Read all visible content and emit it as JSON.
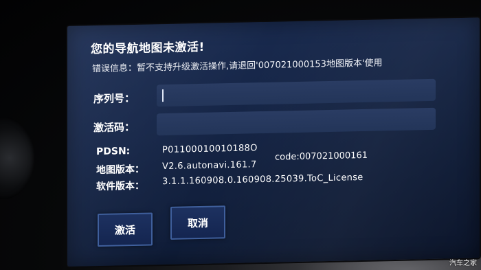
{
  "dialog": {
    "title": "您的导航地图未激活!",
    "error_text": "错误信息：暂不支持升级激活操作,请退回'007021000153地图版本'使用"
  },
  "form": {
    "serial_label": "序列号：",
    "serial_value": "",
    "activation_label": "激活码：",
    "activation_value": ""
  },
  "info": {
    "pdsn_label": "PDSN:",
    "pdsn_value": "P01100010010188O",
    "map_version_label": "地图版本：",
    "map_version_value": "V2.6.autonavi.161.7",
    "map_code": "code:007021000161",
    "software_version_label": "软件版本：",
    "software_version_value": "3.1.1.160908.0.160908.25039.ToC_License"
  },
  "buttons": {
    "activate_label": "激活",
    "cancel_label": "取消"
  },
  "watermark": "汽车之家",
  "colors": {
    "screen_bg": "#162648",
    "input_bg": "#2a3c63",
    "button_border": "#3f5f9c"
  }
}
